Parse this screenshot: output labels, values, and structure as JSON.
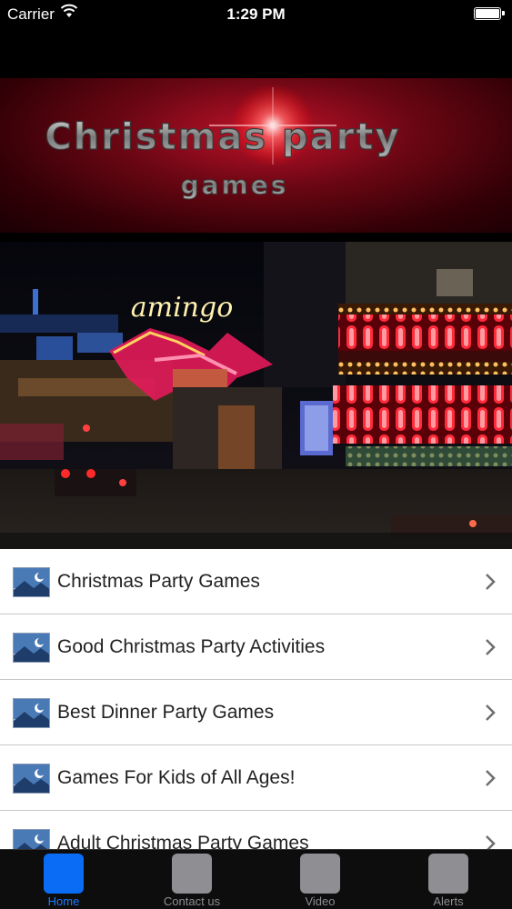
{
  "status_bar": {
    "carrier": "Carrier",
    "time": "1:29 PM",
    "wifi_icon": "wifi-icon",
    "battery_icon": "battery-icon"
  },
  "banner": {
    "title_line1": "Christmas party",
    "title_line2": "games",
    "colors": {
      "background": "#6d0714",
      "text": "#9a9a9a"
    }
  },
  "hero": {
    "description_icon": "photo",
    "sign_text": "amingo"
  },
  "list": {
    "items": [
      {
        "label": "Christmas Party Games"
      },
      {
        "label": "Good Christmas Party Activities"
      },
      {
        "label": "Best Dinner Party Games"
      },
      {
        "label": "Games For Kids of All Ages!"
      },
      {
        "label": "Adult Christmas Party Games"
      }
    ],
    "chevron_icon": "chevron-right-icon",
    "thumb_icon": "moon-landscape-icon"
  },
  "tab_bar": {
    "tabs": [
      {
        "label": "Home",
        "active": true
      },
      {
        "label": "Contact us",
        "active": false
      },
      {
        "label": "Video",
        "active": false
      },
      {
        "label": "Alerts",
        "active": false
      }
    ],
    "colors": {
      "active": "#1a7cff",
      "inactive": "#8e8e93"
    }
  }
}
